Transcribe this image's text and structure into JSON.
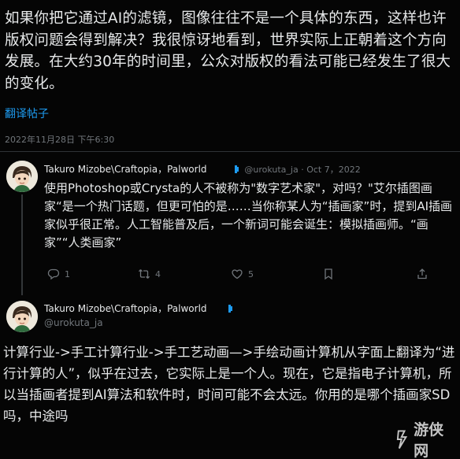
{
  "tweet": {
    "text": "如果你把它通过AI的滤镜，图像往往不是一个具体的东西，这样也许版权问题会得到解决？我很惊讶地看到，世界实际上正朝着这个方向发展。在大约30年的时间里，公众对版权的看法可能已经发生了很大的变化。",
    "translate_label": "翻译帖子",
    "timestamp": "2022年11月28日 下午6:30"
  },
  "reply1": {
    "display_name": "Takuro Mizobe\\Craftopia，Palworld",
    "meta": "@urokuta_ja · Oct 7，2022",
    "text": "使用Photoshop或Crysta的人不被称为\"数字艺术家\"，对吗？\"艾尔插图画家“是一个热门话题，但更可怕的是……当你称某人为“插画家”时，提到AI插画家似乎很正常。人工智能普及后，一个新词可能会诞生：模拟插画师。“画家”“人类画家”",
    "actions": {
      "reply_count": "1",
      "retweet_count": "4",
      "like_count": "5"
    }
  },
  "reply2": {
    "display_name": "Takuro Mizobe\\Craftopia，Palworld",
    "handle": "@urokuta_ja",
    "text": "计算行业->手工计算行业->手工艺动画—>手绘动画计算机从字面上翻译为“进行计算的人”，似乎在过去，它实际上是一个人。现在，它是指电子计算机，所以当插画者提到AI算法和软件时，时间可能不会太远。你用的是哪个插画家SD吗，中途吗"
  },
  "watermark": {
    "text": "游侠网"
  },
  "colors": {
    "background": "#050505",
    "text": "#e7e9ea",
    "secondary": "#71767b",
    "link": "#1d9bf0"
  }
}
